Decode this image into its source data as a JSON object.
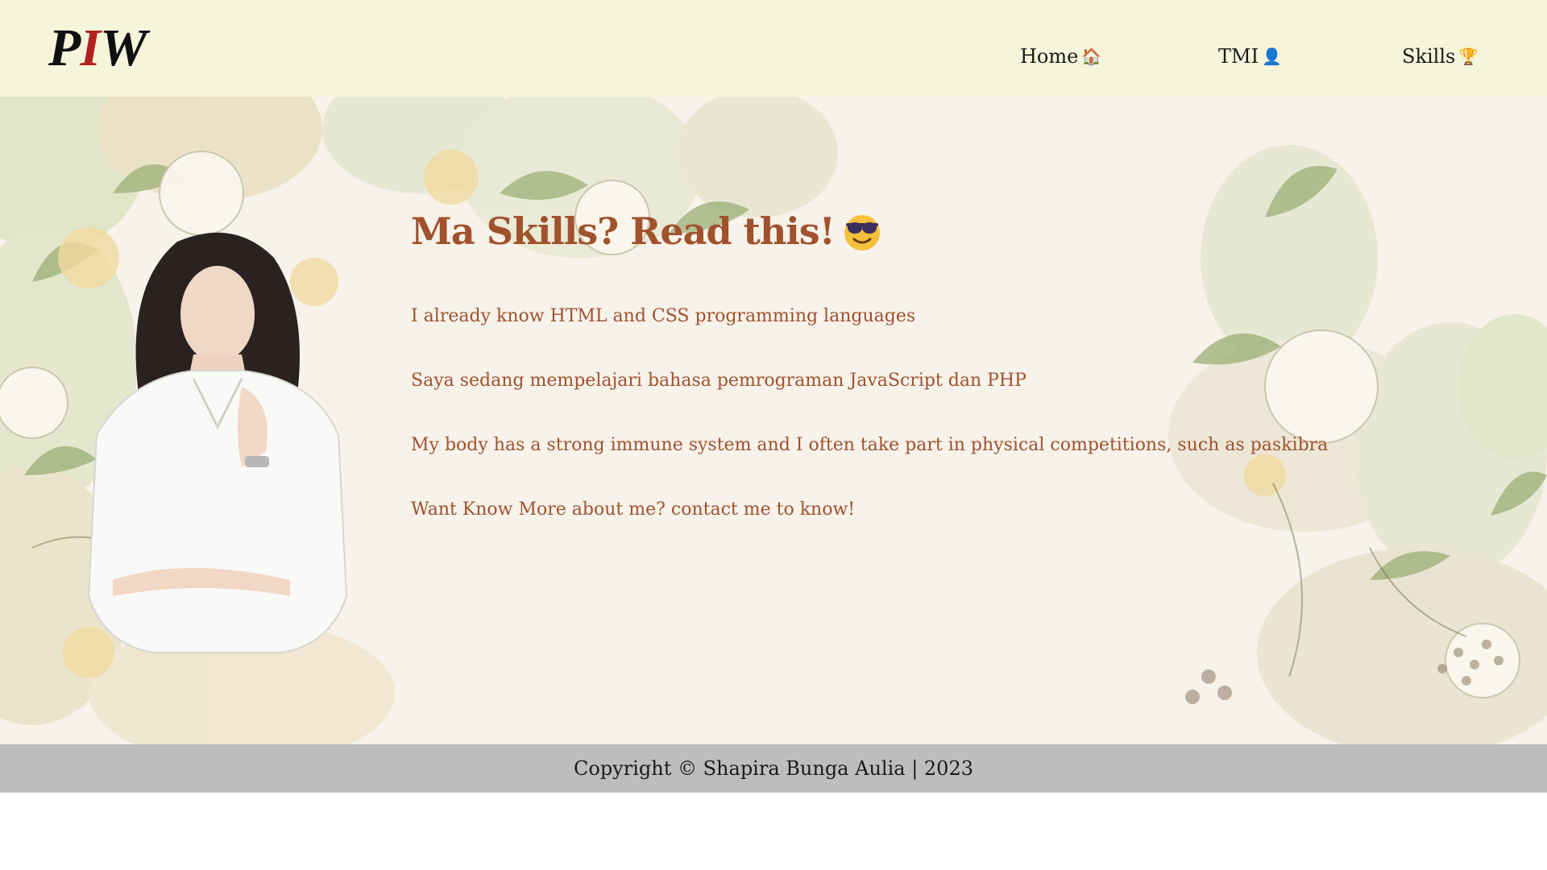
{
  "navbar": {
    "logo": {
      "left": "P",
      "mid": "I",
      "right": "W"
    },
    "items": [
      {
        "label": "Home",
        "icon": "house-icon",
        "glyph": "🏠"
      },
      {
        "label": "TMI",
        "icon": "person-icon",
        "glyph": "👤"
      },
      {
        "label": "Skills",
        "icon": "trophy-icon",
        "glyph": "🏆"
      }
    ]
  },
  "main": {
    "heading": "Ma Skills? Read this!",
    "heading_icon": "sunglasses-emoji-icon",
    "paragraphs": [
      "I already know HTML and CSS programming languages",
      "Saya sedang mempelajari bahasa pemrograman JavaScript dan PHP",
      "My body has a strong immune system and I often take part in physical competitions, such as paskibra",
      "Want Know More about me? contact me to know!"
    ]
  },
  "footer": {
    "copyright": "Copyright © Shapira Bunga Aulia | 2023"
  },
  "colors": {
    "navbar_bg": "#f5f5dc",
    "accent_text": "#a0522d",
    "logo_accent": "#b22222",
    "footer_bg": "#bdbdbd"
  }
}
